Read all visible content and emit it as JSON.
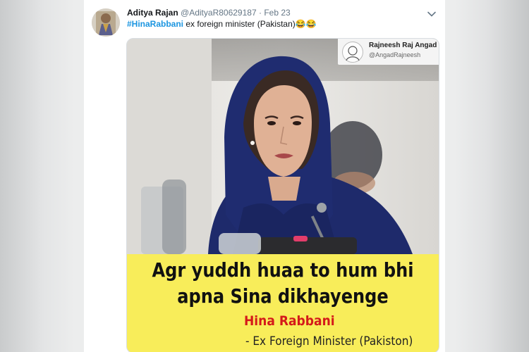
{
  "tweet": {
    "display_name": "Aditya Rajan",
    "handle": "@AdityaR80629187",
    "separator": "·",
    "date": "Feb 23",
    "hashtag": "#HinaRabbani",
    "text": " ex foreign minister (Pakistan)",
    "emojis": "😂😂",
    "more_icon": "chevron-down-icon"
  },
  "media": {
    "credit": {
      "name": "Rajneesh Raj Angad",
      "handle": "@AngadRajneesh"
    },
    "caption": {
      "line1": "Agr yuddh huaa to hum bhi",
      "line2": "apna Sina dikhayenge",
      "name": "Hina Rabbani",
      "title": "- Ex Foreign Minister (Pakiston)"
    }
  },
  "colors": {
    "hashtag": "#1b95e0",
    "caption_bg": "#f8ed5a",
    "caption_name": "#d41a1a",
    "scarf": "#1e2a6b"
  }
}
